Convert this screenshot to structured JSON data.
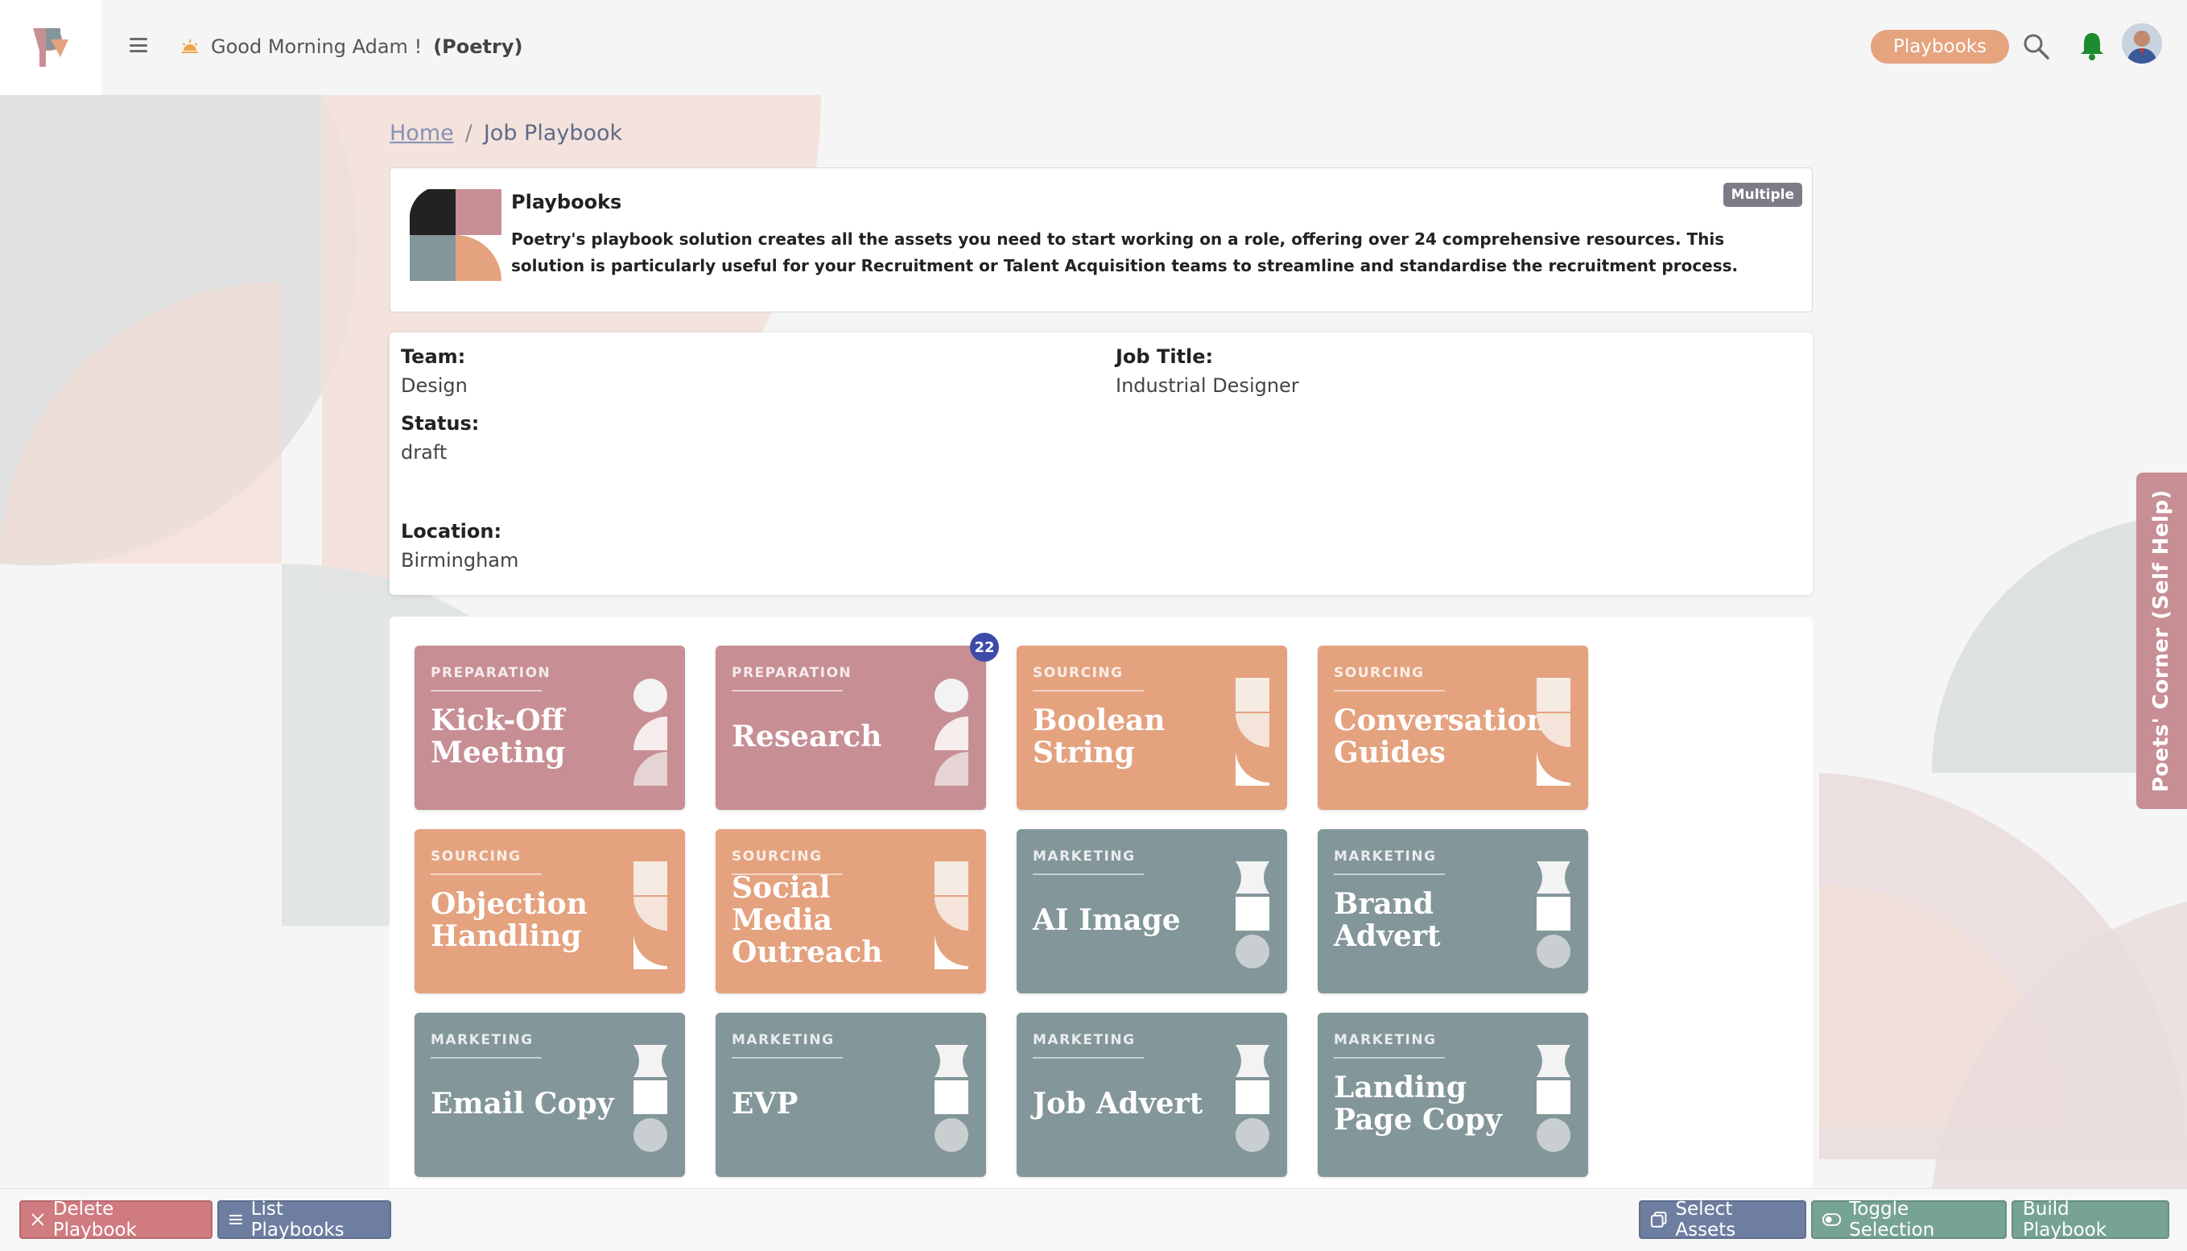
{
  "header": {
    "greeting": "Good Morning Adam !",
    "org": "(Poetry)",
    "playbooks_button": "Playbooks"
  },
  "breadcrumb": {
    "home": "Home",
    "separator": "/",
    "current": "Job Playbook"
  },
  "info": {
    "title": "Playbooks",
    "badge": "Multiple",
    "description": "Poetry's playbook solution creates all the assets you need to start working on a role, offering over 24 comprehensive resources. This solution is particularly useful for your Recruitment or Talent Acquisition teams to streamline and standardise the recruitment process."
  },
  "details": {
    "team_label": "Team:",
    "team_value": "Design",
    "job_title_label": "Job Title:",
    "job_title_value": "Industrial Designer",
    "status_label": "Status:",
    "status_value": "draft",
    "location_label": "Location:",
    "location_value": "Birmingham"
  },
  "assets": [
    {
      "category": "PREPARATION",
      "title": "Kick-Off Meeting",
      "type": "prep",
      "icon": "circle-leaf-icon"
    },
    {
      "category": "PREPARATION",
      "title": "Research",
      "type": "prep",
      "icon": "circle-leaf-icon",
      "badge": "22"
    },
    {
      "category": "SOURCING",
      "title": "Boolean String",
      "type": "src",
      "icon": "square-leaf-icon"
    },
    {
      "category": "SOURCING",
      "title": "Conversation Guides",
      "type": "src",
      "icon": "square-leaf-icon"
    },
    {
      "category": "SOURCING",
      "title": "Objection Handling",
      "type": "src",
      "icon": "square-leaf-icon"
    },
    {
      "category": "SOURCING",
      "title": "Social Media Outreach",
      "type": "src",
      "icon": "square-leaf-icon"
    },
    {
      "category": "MARKETING",
      "title": "AI Image",
      "type": "mkt",
      "icon": "star-square-circle-icon"
    },
    {
      "category": "MARKETING",
      "title": "Brand Advert",
      "type": "mkt",
      "icon": "star-square-circle-icon"
    },
    {
      "category": "MARKETING",
      "title": "Email Copy",
      "type": "mkt",
      "icon": "star-square-circle-icon"
    },
    {
      "category": "MARKETING",
      "title": "EVP",
      "type": "mkt",
      "icon": "star-square-circle-icon"
    },
    {
      "category": "MARKETING",
      "title": "Job Advert",
      "type": "mkt",
      "icon": "star-square-circle-icon"
    },
    {
      "category": "MARKETING",
      "title": "Landing Page Copy",
      "type": "mkt",
      "icon": "star-square-circle-icon"
    }
  ],
  "side_tab": "Poets' Corner (Self Help)",
  "footer": {
    "delete": "Delete Playbook",
    "list": "List Playbooks",
    "select": "Select Assets",
    "toggle": "Toggle Selection",
    "build": "Build Playbook"
  },
  "colors": {
    "preparation": "#c78e94",
    "sourcing": "#e4a27f",
    "marketing": "#839699",
    "badge": "#3d4ba8",
    "accent_pill": "#e5a37e",
    "bell": "#1e8a2e"
  }
}
